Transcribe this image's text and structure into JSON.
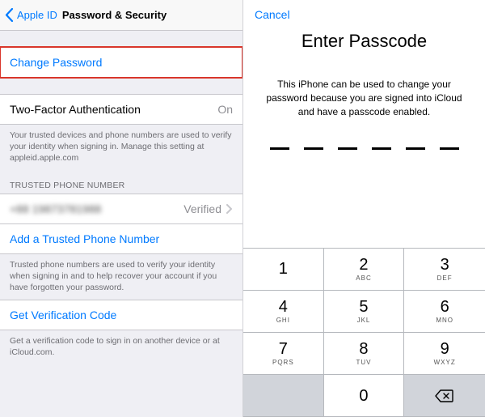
{
  "colors": {
    "accent": "#007aff",
    "highlight": "#d9362b"
  },
  "left": {
    "back_label": "Apple ID",
    "title": "Password & Security",
    "change_password": "Change Password",
    "two_factor_label": "Two-Factor Authentication",
    "two_factor_value": "On",
    "two_factor_desc": "Your trusted devices and phone numbers are used to verify your identity when signing in. Manage this setting at appleid.apple.com",
    "trusted_phone_header": "TRUSTED PHONE NUMBER",
    "phone_value": "+88 19873781988",
    "phone_status": "Verified",
    "add_trusted": "Add a Trusted Phone Number",
    "trusted_desc": "Trusted phone numbers are used to verify your identity when signing in and to help recover your account if you have forgotten your password.",
    "get_code": "Get Verification Code",
    "get_code_desc": "Get a verification code to sign in on another device or at iCloud.com."
  },
  "right": {
    "cancel": "Cancel",
    "title": "Enter Passcode",
    "desc": "This iPhone can be used to change your password because you are signed into iCloud and have a passcode enabled.",
    "passcode_length": 6,
    "keypad": [
      {
        "digit": "1",
        "letters": ""
      },
      {
        "digit": "2",
        "letters": "ABC"
      },
      {
        "digit": "3",
        "letters": "DEF"
      },
      {
        "digit": "4",
        "letters": "GHI"
      },
      {
        "digit": "5",
        "letters": "JKL"
      },
      {
        "digit": "6",
        "letters": "MNO"
      },
      {
        "digit": "7",
        "letters": "PQRS"
      },
      {
        "digit": "8",
        "letters": "TUV"
      },
      {
        "digit": "9",
        "letters": "WXYZ"
      },
      {
        "digit": "0",
        "letters": ""
      }
    ]
  }
}
